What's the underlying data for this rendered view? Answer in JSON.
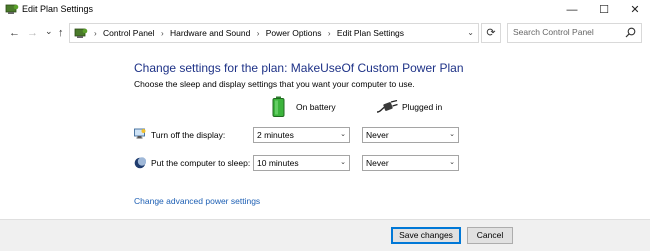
{
  "window": {
    "title": "Edit Plan Settings",
    "minimize": "—",
    "maximize": "☐",
    "close": "✕"
  },
  "nav": {
    "back": "←",
    "forward": "→",
    "recent": "⌄",
    "up": "↑"
  },
  "address": {
    "crumbs": [
      "Control Panel",
      "Hardware and Sound",
      "Power Options",
      "Edit Plan Settings"
    ],
    "separator": "›",
    "dropdown": "⌄",
    "refresh": "⟳"
  },
  "search": {
    "placeholder": "Search Control Panel"
  },
  "main": {
    "heading": "Change settings for the plan: MakeUseOf Custom Power Plan",
    "subtext": "Choose the sleep and display settings that you want your computer to use.",
    "columns": {
      "on_battery": "On battery",
      "plugged_in": "Plugged in"
    },
    "rows": [
      {
        "label": "Turn off the display:",
        "battery": "2 minutes",
        "plugged": "Never"
      },
      {
        "label": "Put the computer to sleep:",
        "battery": "10 minutes",
        "plugged": "Never"
      }
    ],
    "caret": "⌄",
    "advanced_link": "Change advanced power settings"
  },
  "footer": {
    "save": "Save changes",
    "cancel": "Cancel"
  },
  "colors": {
    "heading": "#1e3287",
    "link": "#1d5fb4",
    "battery_green": "#3cb43c",
    "primary_border": "#0078d7",
    "footer_bg": "#f0f0f0"
  },
  "icons": {
    "app": "power-options-icon",
    "battery": "battery-icon",
    "plug": "plug-icon",
    "display": "display-icon",
    "sleep": "sleep-moon-icon",
    "search": "search-icon",
    "refresh": "refresh-icon"
  }
}
